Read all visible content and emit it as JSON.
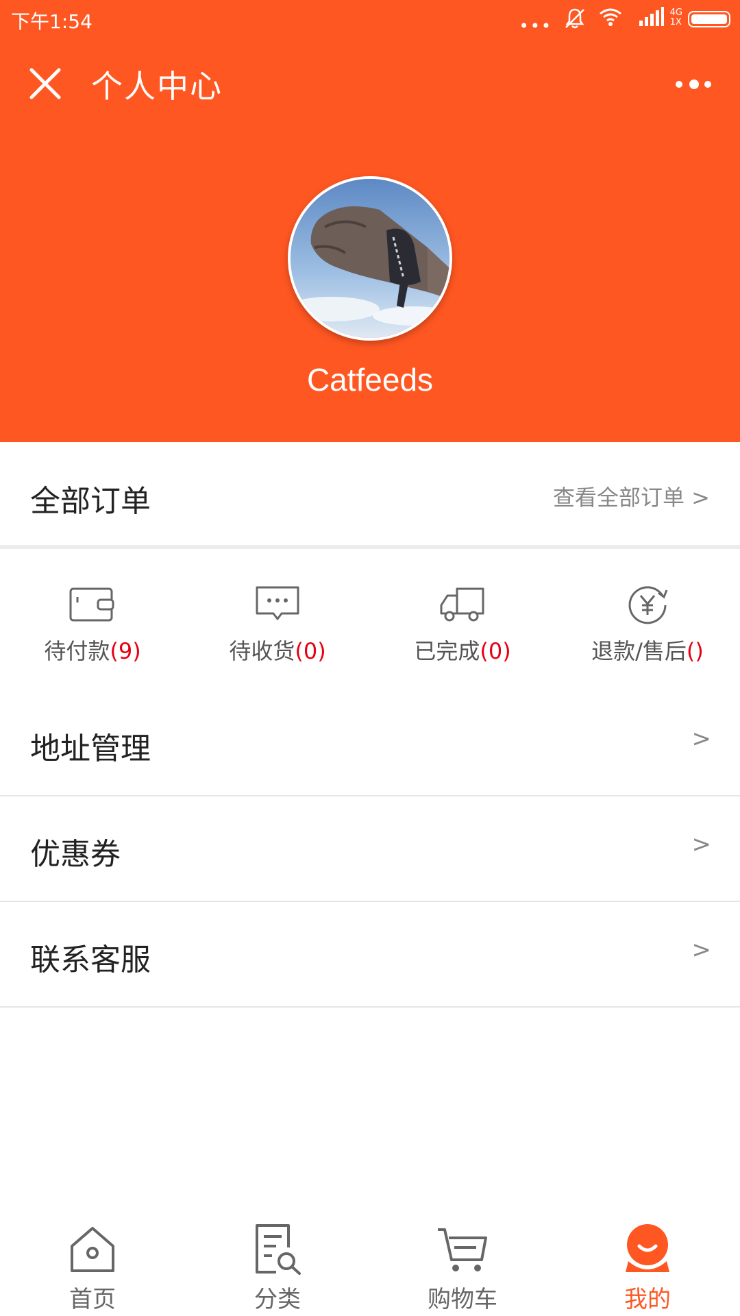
{
  "status_bar": {
    "time": "下午1:54",
    "network": "4G\n1X",
    "icons": [
      "more-dots-icon",
      "silent-icon",
      "wifi-icon",
      "signal-icon",
      "battery-icon"
    ]
  },
  "nav": {
    "title": "个人中心",
    "close_icon": "close-icon",
    "more_icon": "more-icon"
  },
  "profile": {
    "username": "Catfeeds"
  },
  "orders": {
    "title": "全部订单",
    "view_all": "查看全部订单 >"
  },
  "order_status": [
    {
      "label": "待付款",
      "count": "(9)",
      "icon": "wallet-icon"
    },
    {
      "label": "待收货",
      "count": "(0)",
      "icon": "message-icon"
    },
    {
      "label": "已完成",
      "count": "(0)",
      "icon": "truck-icon"
    },
    {
      "label": "退款/售后",
      "count": "()",
      "icon": "refund-icon"
    }
  ],
  "menu": [
    {
      "label": "地址管理",
      "chevron": ">"
    },
    {
      "label": "优惠券",
      "chevron": ">"
    },
    {
      "label": "联系客服",
      "chevron": ">"
    }
  ],
  "tabs": [
    {
      "label": "首页",
      "icon": "home-icon"
    },
    {
      "label": "分类",
      "icon": "category-search-icon"
    },
    {
      "label": "购物车",
      "icon": "cart-icon"
    },
    {
      "label": "我的",
      "icon": "profile-icon",
      "active": true
    }
  ],
  "colors": {
    "brand": "#ff5722",
    "count_red": "#e60012"
  }
}
